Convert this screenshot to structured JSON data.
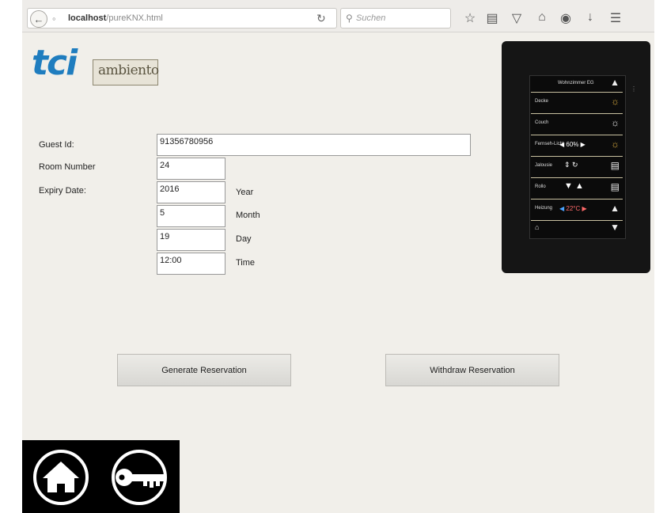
{
  "browser": {
    "url_host": "localhost",
    "url_path": "/pureKNX.html",
    "search_placeholder": "Suchen"
  },
  "logo": {
    "brand": "tci",
    "sub": "ambiento"
  },
  "form": {
    "guest_id_label": "Guest Id:",
    "guest_id_value": "91356780956",
    "room_label": "Room Number",
    "room_value": "24",
    "expiry_label": "Expiry Date:",
    "year_value": "2016",
    "year_label": "Year",
    "month_value": "5",
    "month_label": "Month",
    "day_value": "19",
    "day_label": "Day",
    "time_value": "12:00",
    "time_label": "Time"
  },
  "buttons": {
    "generate": "Generate Reservation",
    "withdraw": "Withdraw Reservation"
  },
  "panel": {
    "header": "Wohnzimmer EG",
    "rows": [
      {
        "label": "Decke",
        "icon": "lamp-icon"
      },
      {
        "label": "Couch",
        "icon": "lamp-icon"
      },
      {
        "label": "Fernseh-Licht",
        "value": "60%",
        "icon": "lamp-icon"
      },
      {
        "label": "Jalousie",
        "icon": "blind-icon"
      },
      {
        "label": "Rollo",
        "icon": "blind-icon"
      },
      {
        "label": "Heizung",
        "value": "22°C",
        "icon": "thermometer-icon"
      }
    ]
  },
  "colors": {
    "brand_blue": "#1f7dbf",
    "page_bg": "#f1efea"
  }
}
